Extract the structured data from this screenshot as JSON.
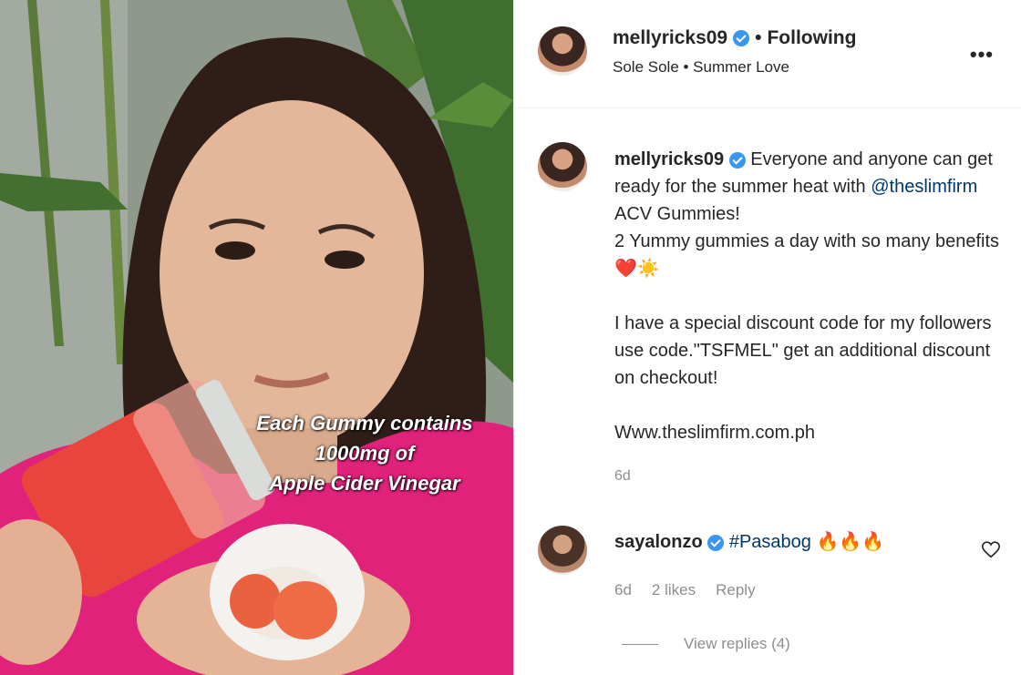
{
  "media": {
    "overlay_lines": [
      "Each Gummy contains",
      "1000mg of",
      "Apple Cider Vinegar"
    ]
  },
  "header": {
    "username": "mellyricks09",
    "separator": "•",
    "follow_status": "Following",
    "audio": "Sole Sole • Summer Love",
    "more_icon": "more-horizontal-icon"
  },
  "caption": {
    "username": "mellyricks09",
    "line1": "Everyone and anyone can get ready for the summer heat with",
    "mention": "@theslimfirm",
    "line2": "ACV Gummies!",
    "line3": "2 Yummy gummies a day with so many benefits",
    "emojis": "❤️☀️",
    "line4": "I have a special discount code for my followers use code.\"TSFMEL\" get an additional discount on checkout!",
    "line5": "Www.theslimfirm.com.ph",
    "time": "6d"
  },
  "comment": {
    "username": "sayalonzo",
    "hashtag": "#Pasabog",
    "emojis": "🔥🔥🔥",
    "time": "6d",
    "likes": "2 likes",
    "reply_label": "Reply",
    "view_replies": "View replies (4)",
    "like_icon": "heart-outline-icon"
  },
  "colors": {
    "verified": "#3897f0",
    "link": "#00376b",
    "muted": "#8e8e8e",
    "text": "#262626"
  }
}
